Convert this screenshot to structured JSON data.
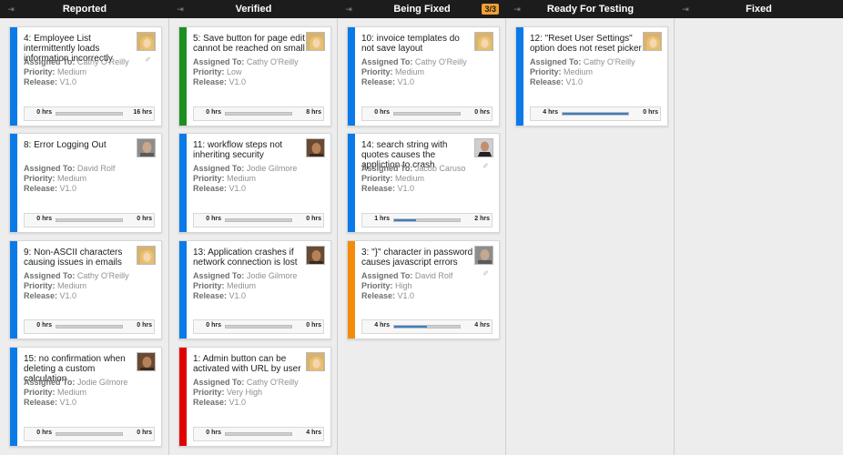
{
  "columns": [
    {
      "title": "Reported",
      "badge": ""
    },
    {
      "title": "Verified",
      "badge": ""
    },
    {
      "title": "Being Fixed",
      "badge": "3/3"
    },
    {
      "title": "Ready For Testing",
      "badge": ""
    },
    {
      "title": "Fixed",
      "badge": ""
    }
  ],
  "labels": {
    "assigned": "Assigned To:",
    "priority": "Priority:",
    "release": "Release:"
  },
  "icons": {
    "collapse": "collapse-icon",
    "attachment": "paperclip-icon"
  },
  "colors": {
    "blue": "#0a7ae8",
    "green": "#1a9020",
    "red": "#e00000",
    "orange": "#f28c0a",
    "progress": "#3a7fc4"
  },
  "cards": [
    {
      "column": 0,
      "title": "4: Employee List intermittently loads information incorrectly",
      "assignee": "Cathy O'Reilly",
      "priority": "Medium",
      "release": "V1.0",
      "spent": "0 hrs",
      "estimate": "16 hrs",
      "progress": 0,
      "color": "blue",
      "avatar": "blonde",
      "attachment": true
    },
    {
      "column": 0,
      "title": "8: Error Logging Out",
      "assignee": "David Rolf",
      "priority": "Medium",
      "release": "V1.0",
      "spent": "0 hrs",
      "estimate": "0 hrs",
      "progress": 0,
      "color": "blue",
      "avatar": "grey",
      "attachment": false
    },
    {
      "column": 0,
      "title": "9: Non-ASCII characters causing issues in emails",
      "assignee": "Cathy O'Reilly",
      "priority": "Medium",
      "release": "V1.0",
      "spent": "0 hrs",
      "estimate": "0 hrs",
      "progress": 0,
      "color": "blue",
      "avatar": "blonde",
      "attachment": false
    },
    {
      "column": 0,
      "title": "15: no confirmation when deleting a custom calculation",
      "assignee": "Jodie Gilmore",
      "priority": "Medium",
      "release": "V1.0",
      "spent": "0 hrs",
      "estimate": "0 hrs",
      "progress": 0,
      "color": "blue",
      "avatar": "dark",
      "attachment": false
    },
    {
      "column": 1,
      "title": "5: Save button for page edit cannot be reached on small",
      "assignee": "Cathy O'Reilly",
      "priority": "Low",
      "release": "V1.0",
      "spent": "0 hrs",
      "estimate": "8 hrs",
      "progress": 0,
      "color": "green",
      "avatar": "blonde",
      "attachment": false
    },
    {
      "column": 1,
      "title": "11: workflow steps not inheriting security",
      "assignee": "Jodie Gilmore",
      "priority": "Medium",
      "release": "V1.0",
      "spent": "0 hrs",
      "estimate": "0 hrs",
      "progress": 0,
      "color": "blue",
      "avatar": "dark",
      "attachment": false
    },
    {
      "column": 1,
      "title": "13: Application crashes if network connection is lost",
      "assignee": "Jodie Gilmore",
      "priority": "Medium",
      "release": "V1.0",
      "spent": "0 hrs",
      "estimate": "0 hrs",
      "progress": 0,
      "color": "blue",
      "avatar": "dark",
      "attachment": false
    },
    {
      "column": 1,
      "title": "1: Admin button can be activated with URL by user",
      "assignee": "Cathy O'Reilly",
      "priority": "Very High",
      "release": "V1.0",
      "spent": "0 hrs",
      "estimate": "4 hrs",
      "progress": 0,
      "color": "red",
      "avatar": "blonde",
      "attachment": false
    },
    {
      "column": 2,
      "title": "10: invoice templates do not save layout",
      "assignee": "Cathy O'Reilly",
      "priority": "Medium",
      "release": "V1.0",
      "spent": "0 hrs",
      "estimate": "0 hrs",
      "progress": 0,
      "color": "blue",
      "avatar": "blonde",
      "attachment": false
    },
    {
      "column": 2,
      "title": "14: search string with quotes causes the appliction to crash",
      "assignee": "Jacob Caruso",
      "priority": "Medium",
      "release": "V1.0",
      "spent": "1 hrs",
      "estimate": "2 hrs",
      "progress": 0.33,
      "color": "blue",
      "avatar": "suit",
      "attachment": true
    },
    {
      "column": 2,
      "title": "3: \"}\" character in password causes javascript errors",
      "assignee": "David Rolf",
      "priority": "High",
      "release": "V1.0",
      "spent": "4 hrs",
      "estimate": "4 hrs",
      "progress": 0.5,
      "color": "orange",
      "avatar": "grey",
      "attachment": true
    },
    {
      "column": 3,
      "title": "12: \"Reset User Settings\" option does not reset picker",
      "assignee": "Cathy O'Reilly",
      "priority": "Medium",
      "release": "V1.0",
      "spent": "4 hrs",
      "estimate": "0 hrs",
      "progress": 1.0,
      "color": "blue",
      "avatar": "blonde",
      "attachment": false
    }
  ]
}
